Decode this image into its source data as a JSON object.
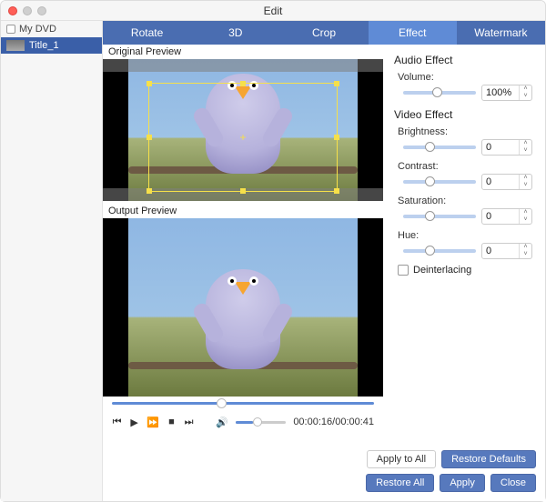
{
  "window": {
    "title": "Edit"
  },
  "sidebar": {
    "root_label": "My DVD",
    "items": [
      {
        "label": "Title_1"
      }
    ]
  },
  "tabs": [
    {
      "id": "rotate",
      "label": "Rotate"
    },
    {
      "id": "3d",
      "label": "3D"
    },
    {
      "id": "crop",
      "label": "Crop"
    },
    {
      "id": "effect",
      "label": "Effect",
      "active": true
    },
    {
      "id": "watermark",
      "label": "Watermark"
    }
  ],
  "preview": {
    "original_label": "Original Preview",
    "output_label": "Output Preview",
    "time_current": "00:00:16",
    "time_total": "00:00:41",
    "progress_pct": 40,
    "volume_pct": 35
  },
  "effects": {
    "audio_section": "Audio Effect",
    "video_section": "Video Effect",
    "volume": {
      "label": "Volume:",
      "value": "100%",
      "slider_pct": 40
    },
    "brightness": {
      "label": "Brightness:",
      "value": "0",
      "slider_pct": 30
    },
    "contrast": {
      "label": "Contrast:",
      "value": "0",
      "slider_pct": 30
    },
    "saturation": {
      "label": "Saturation:",
      "value": "0",
      "slider_pct": 30
    },
    "hue": {
      "label": "Hue:",
      "value": "0",
      "slider_pct": 30
    },
    "deinterlace_label": "Deinterlacing",
    "deinterlace_checked": false
  },
  "buttons": {
    "apply_all": "Apply to All",
    "restore_defaults": "Restore Defaults",
    "restore_all": "Restore All",
    "apply": "Apply",
    "close": "Close"
  },
  "colors": {
    "accent": "#5779bd",
    "tab_bg": "#4a6db1",
    "tab_active": "#5f8bd6"
  }
}
